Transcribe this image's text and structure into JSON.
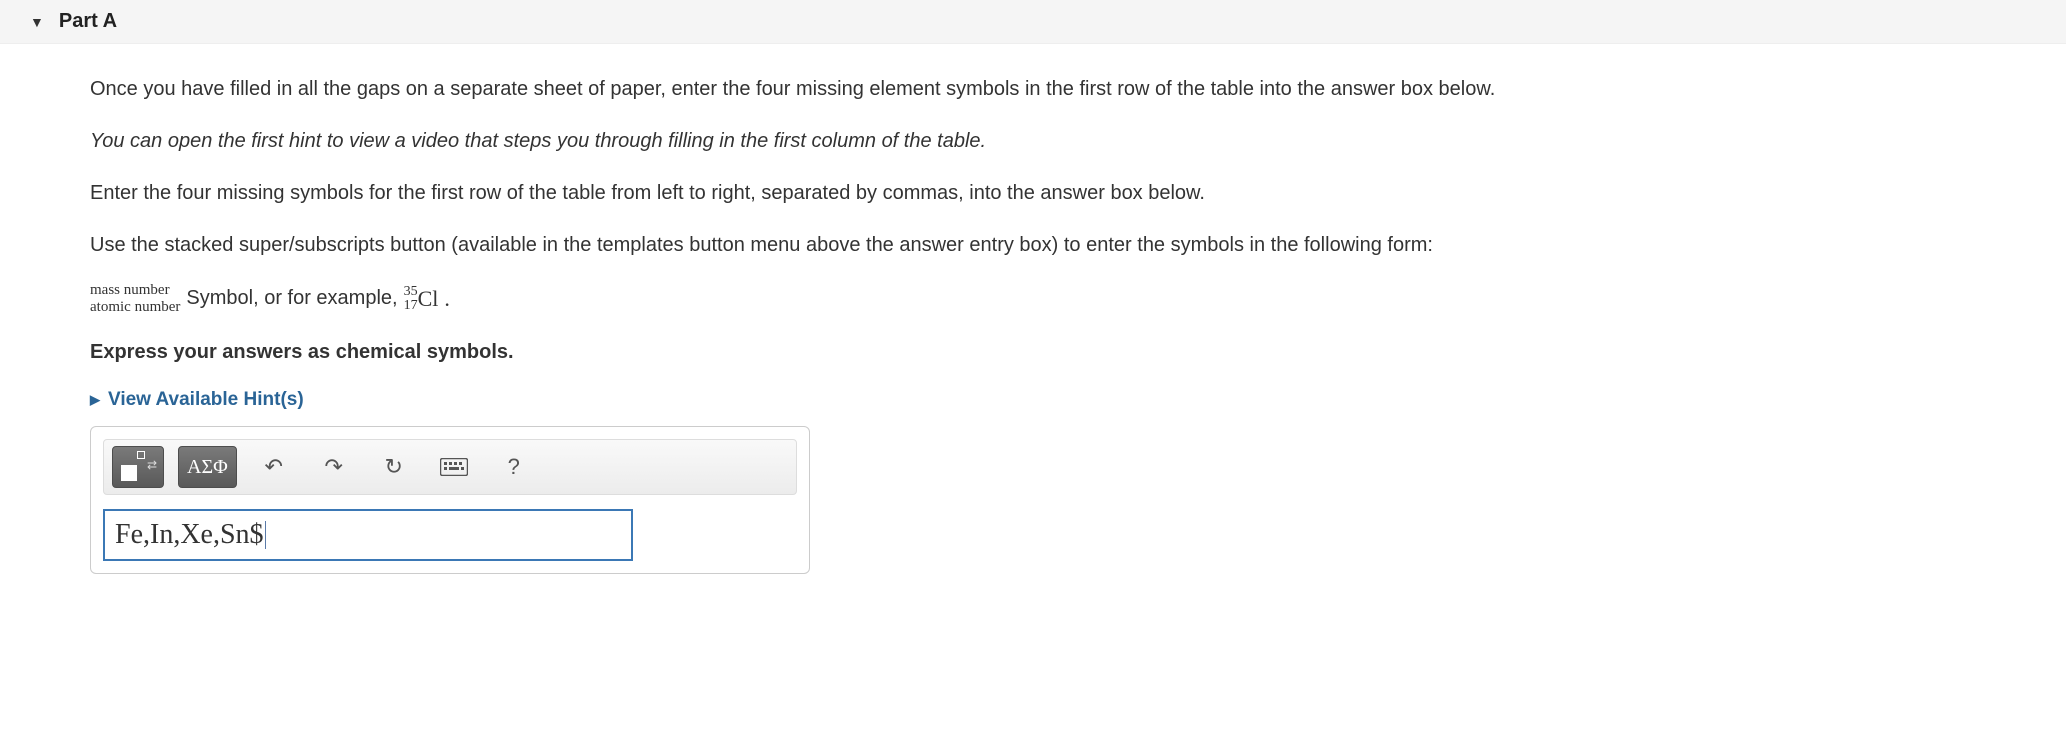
{
  "header": {
    "title": "Part A"
  },
  "question": {
    "p1": "Once you have filled in all the gaps on a separate sheet of paper, enter the four missing element symbols in the first row of the table into the answer box below.",
    "p2": "You can open the first hint to view a video that steps you through filling in the first column of the table.",
    "p3": "Enter the four missing symbols for the first row of the table from left to right, separated by commas, into the answer box below.",
    "p4": "Use the stacked super/subscripts button (available in the templates button menu above the answer entry box) to enter the symbols in the following form:",
    "stack_top": "mass number",
    "stack_bottom": "atomic number",
    "symbol_text_1": " Symbol, or for example, ",
    "example_mass": "35",
    "example_atomic": "17",
    "example_symbol": "Cl",
    "period": ".",
    "p5": "Express your answers as chemical symbols."
  },
  "hints": {
    "label": "View Available Hint(s)"
  },
  "toolbar": {
    "greek_label": "ΑΣΦ",
    "help_label": "?"
  },
  "answer": {
    "value": "Fe,In,Xe,Sn$"
  }
}
